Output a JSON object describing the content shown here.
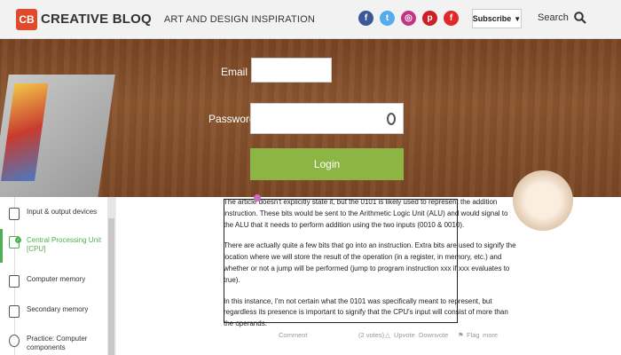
{
  "header": {
    "logo_badge": "CB",
    "logo_text": "CREATIVE BLOQ",
    "tagline": "ART AND DESIGN INSPIRATION",
    "social": [
      {
        "name": "facebook-icon",
        "glyph": "f",
        "color": "#3b5998"
      },
      {
        "name": "twitter-icon",
        "glyph": "t",
        "color": "#55acee"
      },
      {
        "name": "instagram-icon",
        "glyph": "◎",
        "color": "#c13584"
      },
      {
        "name": "pinterest-icon",
        "glyph": "p",
        "color": "#cb2027"
      },
      {
        "name": "flipboard-icon",
        "glyph": "f",
        "color": "#e12828"
      }
    ],
    "subscribe_label": "Subscribe",
    "search_label": "Search"
  },
  "login": {
    "email_label": "Email",
    "email_value": "",
    "password_label": "Password",
    "password_value": "",
    "button_label": "Login"
  },
  "sidebar": {
    "items": [
      {
        "label": "Input & output devices",
        "active": false
      },
      {
        "label": "Central Processing Unit [CPU]",
        "active": true
      },
      {
        "label": "Computer memory",
        "active": false
      },
      {
        "label": "Secondary memory",
        "active": false
      },
      {
        "label": "Practice: Computer components",
        "active": false
      }
    ]
  },
  "article": {
    "paragraphs": [
      "The article doesn't explicitly state it, but the 0101 is likely used to represent the addition instruction. These bits would be sent to the Arithmetic Logic Unit (ALU) and would signal to the ALU that it needs to perform addition using the two inputs (0010 & 0010).",
      "There are actually quite a few bits that go into an instruction. Extra bits are used to signify the location where we will store the result of the operation (in a register, in memory, etc.) and whether or not a jump will be performed (jump to program instruction xxx if xxx evaluates to true).",
      "In this instance, I'm not certain what the 0101 was specifically meant to represent, but regardless its presence is important to signify that the CPU's input will consist of more than the operands."
    ]
  },
  "comment_bar": {
    "comment": "Comment",
    "votes": "(2 votes)",
    "upvote": "Upvote",
    "downvote": "Downvote",
    "flag": "Flag",
    "more": "more"
  },
  "colors": {
    "accent_green": "#4caf50",
    "login_green": "#8db543",
    "brand_red": "#e04a2a"
  }
}
